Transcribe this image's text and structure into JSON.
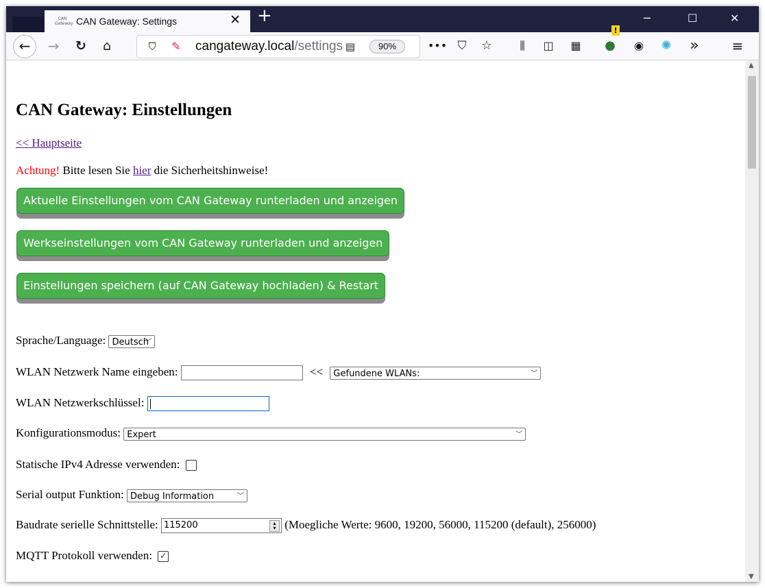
{
  "browser": {
    "tab_title": "CAN Gateway: Settings",
    "favicon_text": "CAN Gateway",
    "url_host": "cangateway.local",
    "url_path": "/settings",
    "zoom": "90%"
  },
  "page": {
    "heading": "CAN Gateway: Einstellungen",
    "back_link": "<< Hauptseite",
    "warning_prefix": "Achtung!",
    "warning_text1": " Bitte lesen Sie ",
    "warning_link": "hier",
    "warning_text2": " die Sicherheitshinweise!",
    "buttons": {
      "download_current": "Aktuelle Einstellungen vom CAN Gateway runterladen und anzeigen",
      "download_factory": "Werkseinstellungen vom CAN Gateway runterladen und anzeigen",
      "save_restart": "Einstellungen speichern (auf CAN Gateway hochladen) & Restart"
    },
    "fields": {
      "language_label": "Sprache/Language:",
      "language_value": "Deutsch",
      "wlan_name_label": "WLAN Netzwerk Name eingeben:",
      "wlan_name_value": "",
      "wlan_arrow": "<<",
      "wlan_found_value": "Gefundene WLANs:",
      "wlan_key_label": "WLAN Netzwerkschlüssel:",
      "config_mode_label": "Konfigurationsmodus:",
      "config_mode_value": "Expert",
      "static_ip_label": "Statische IPv4 Adresse verwenden:",
      "static_ip_checked": false,
      "serial_output_label": "Serial output Funktion:",
      "serial_output_value": "Debug Information",
      "baud_label": "Baudrate serielle Schnittstelle:",
      "baud_value": "115200",
      "baud_hint": "(Moegliche Werte: 9600, 19200, 56000, 115200 (default), 256000)",
      "mqtt_label": "MQTT Protokoll verwenden:",
      "mqtt_checked": true
    }
  },
  "colors": {
    "titlebar": "#20213f",
    "button_green": "#4cb04f",
    "warning_red": "#ff0000",
    "link_visited": "#551a8b"
  }
}
